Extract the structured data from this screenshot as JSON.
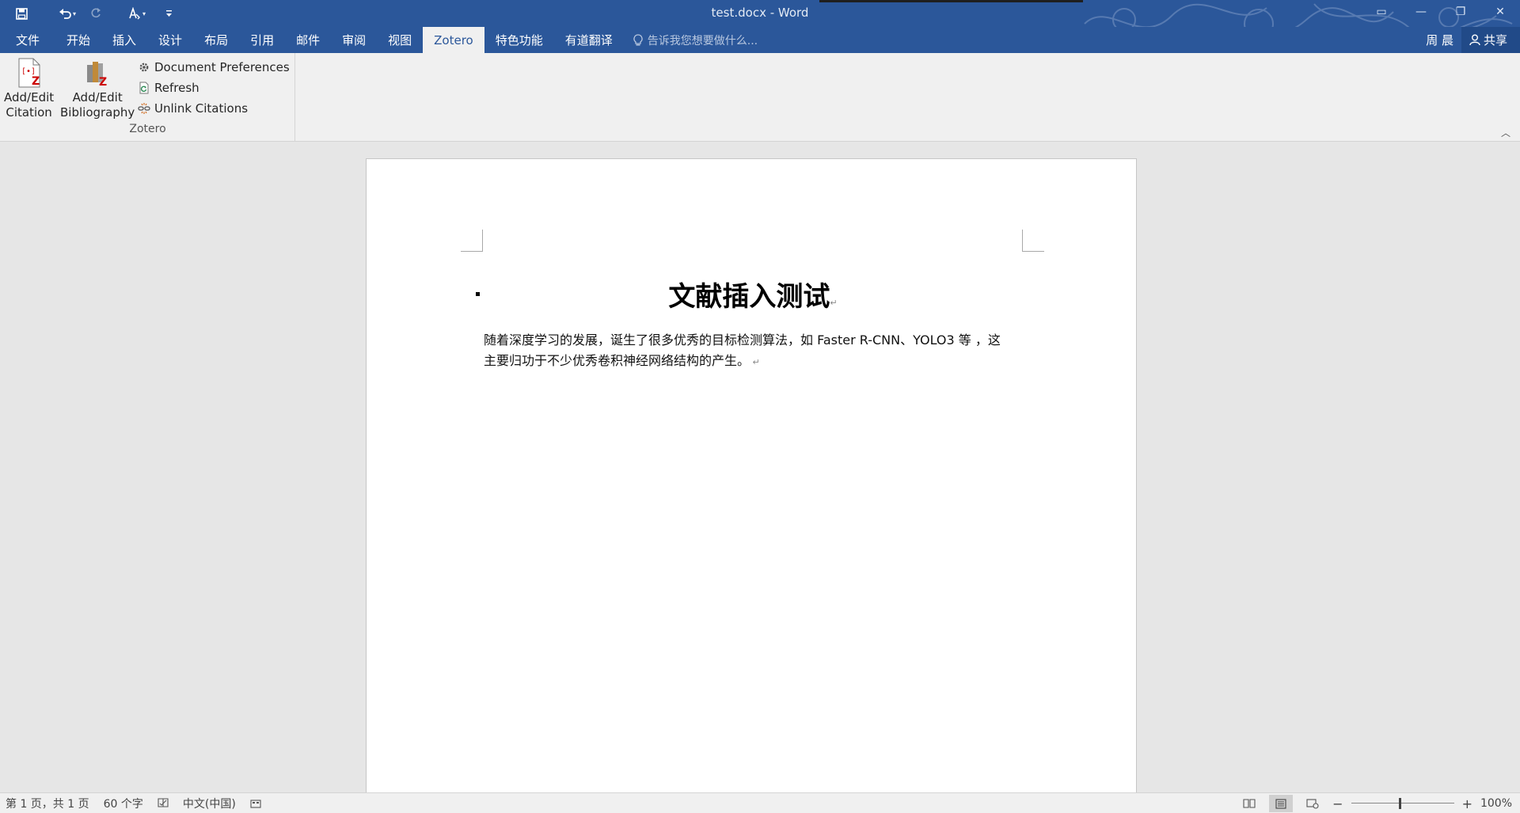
{
  "window": {
    "title": "test.docx - Word",
    "controls": [
      "ribbon-display",
      "minimize",
      "restore",
      "close"
    ]
  },
  "qat": {
    "items": [
      "save-icon",
      "undo-icon",
      "redo-icon",
      "touch-mode-icon",
      "customize-qat-icon"
    ]
  },
  "tabs": {
    "file": "文件",
    "items": [
      "开始",
      "插入",
      "设计",
      "布局",
      "引用",
      "邮件",
      "审阅",
      "视图",
      "Zotero",
      "特色功能",
      "有道翻译"
    ],
    "active": "Zotero",
    "tell_me": "告诉我您想要做什么...",
    "user": "周 晨",
    "share": "共享"
  },
  "ribbon": {
    "add_citation": [
      "Add/Edit",
      "Citation"
    ],
    "add_bibliography": [
      "Add/Edit",
      "Bibliography"
    ],
    "doc_prefs": "Document Preferences",
    "refresh": "Refresh",
    "unlink": "Unlink Citations",
    "group_label": "Zotero"
  },
  "document": {
    "heading": "文献插入测试",
    "paragraph_line1": "随着深度学习的发展，诞生了很多优秀的目标检测算法，如 Faster R-CNN、YOLO3 等 ，这",
    "paragraph_line2": "主要归功于不少优秀卷积神经网络结构的产生。"
  },
  "status": {
    "page": "第 1 页，共 1 页",
    "words": "60 个字",
    "language": "中文(中国)",
    "zoom": "100%",
    "zoom_level_percent": 100
  },
  "colors": {
    "brand": "#2b579a",
    "ribbon_bg": "#f0f0f0",
    "canvas_bg": "#e6e6e6"
  }
}
